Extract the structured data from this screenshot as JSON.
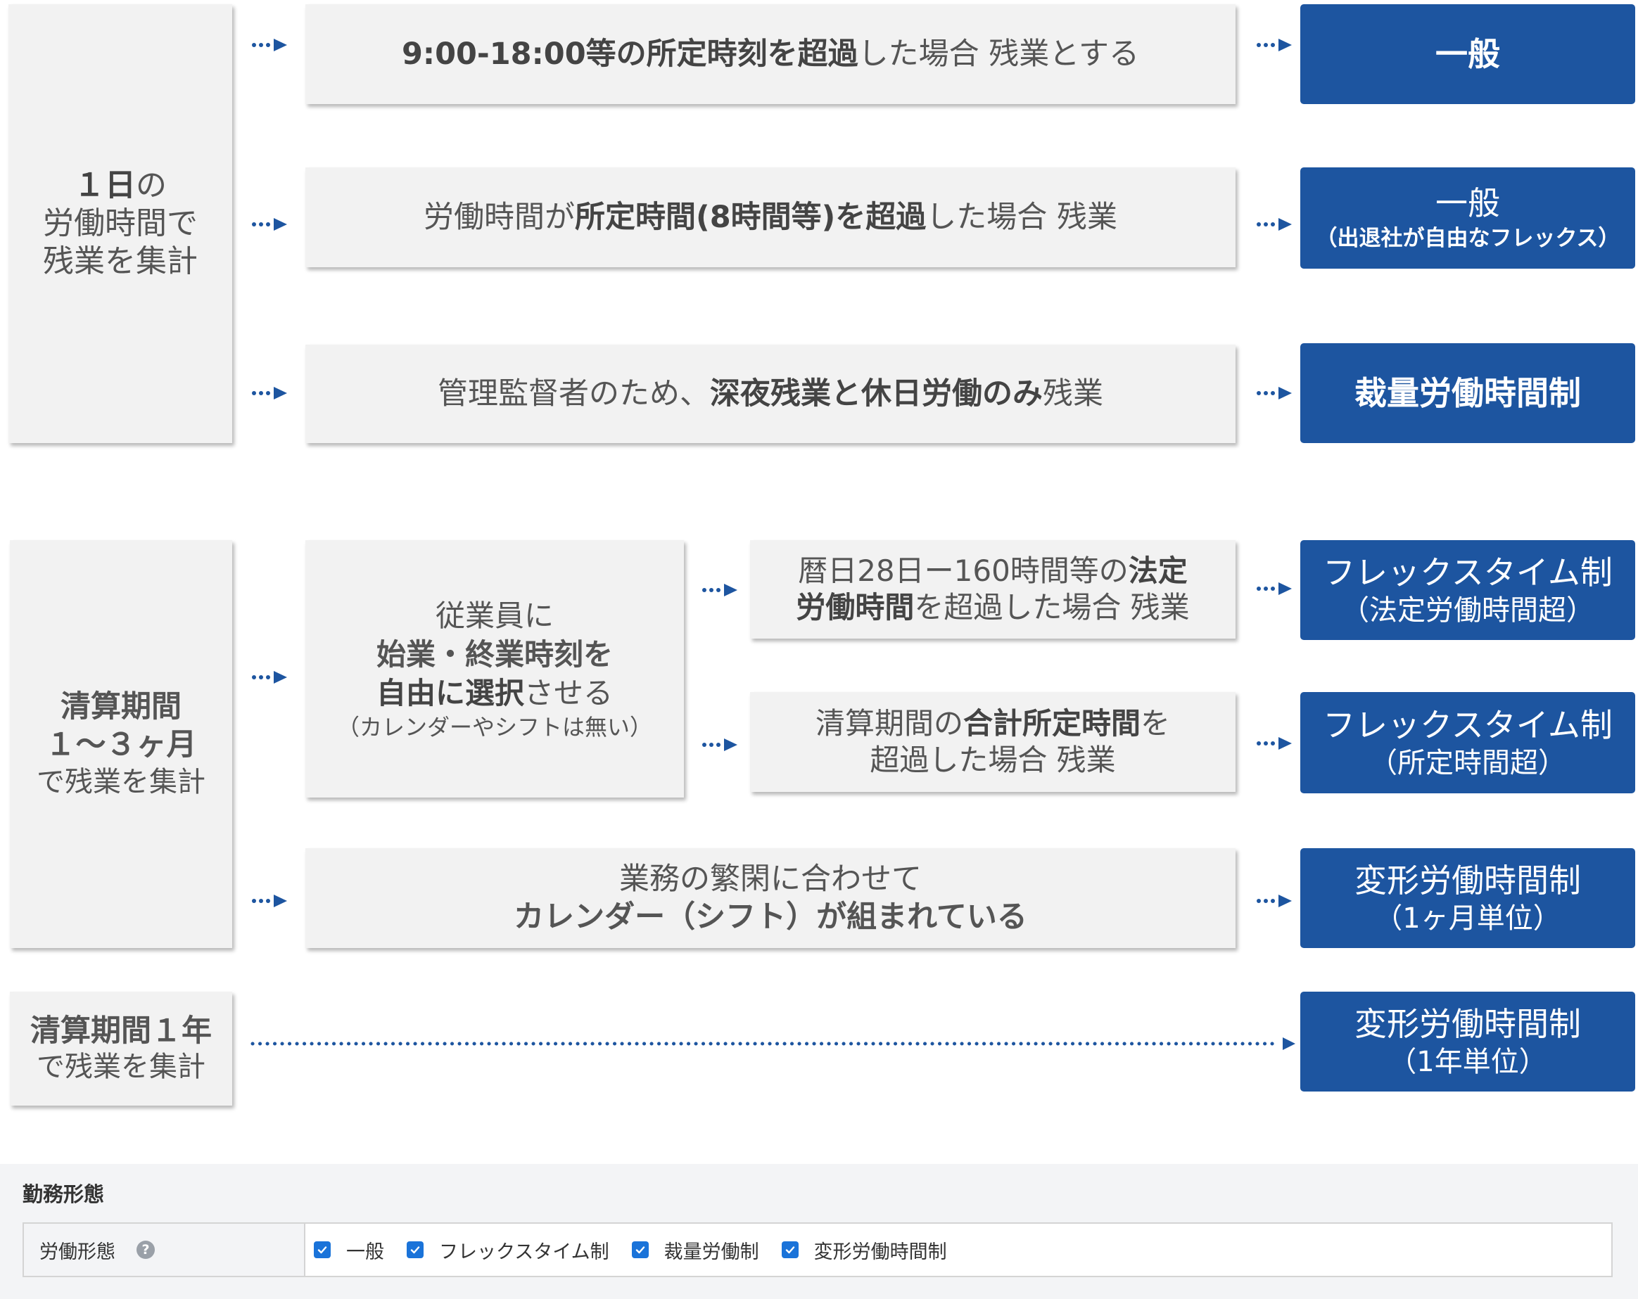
{
  "left_groups": {
    "g1": {
      "p1": "１日",
      "p1b": "の",
      "p2": "労働時間で",
      "p3": "残業を集計"
    },
    "g2": {
      "p1": "清算期間",
      "p2": "１～３ヶ月",
      "p3": "で残業を集計"
    },
    "g3": {
      "p1": "清算期間１年",
      "p2": "で残業を集計"
    }
  },
  "conditions": {
    "c1": {
      "bold": "9:00-18:00等の所定時刻を超過",
      "rest": "した場合 残業とする"
    },
    "c2": {
      "pre": "労働時間が",
      "bold": "所定時間(8時間等)を超過",
      "rest": "した場合 残業"
    },
    "c3": {
      "pre": "管理監督者のため、",
      "bold": "深夜残業と休日労働のみ",
      "rest": "残業"
    },
    "flex": {
      "line1": "従業員に",
      "line2": "始業・終業時刻を",
      "line3_bold": "自由に選択",
      "line3_rest": "させる",
      "line4": "（カレンダーやシフトは無い）"
    },
    "c4": {
      "pre": "暦日28日ー160時間等の",
      "bold1": "法定",
      "bold2": "労働時間",
      "rest": "を超過した場合 残業"
    },
    "c5": {
      "pre": "清算期間の",
      "bold": "合計所定時間",
      "post": "を",
      "line2": "超過した場合 残業"
    },
    "c6": {
      "line1": "業務の繁閑に合わせて",
      "line2": "カレンダー（シフト）が組まれている"
    }
  },
  "results": {
    "r1": {
      "main": "一般"
    },
    "r2": {
      "main": "一般",
      "sub": "（出退社が自由なフレックス）"
    },
    "r3": {
      "main": "裁量労働時間制"
    },
    "r4": {
      "main": "フレックスタイム制",
      "sub": "（法定労働時間超）"
    },
    "r5": {
      "main": "フレックスタイム制",
      "sub": "（所定時間超）"
    },
    "r6": {
      "main": "変形労働時間制",
      "sub": "（1ヶ月単位）"
    },
    "r7": {
      "main": "変形労働時間制",
      "sub": "（1年単位）"
    }
  },
  "settings": {
    "section_title": "勤務形態",
    "row_label": "労働形態",
    "help_icon": "?",
    "options": [
      {
        "label": "一般",
        "checked": true
      },
      {
        "label": "フレックスタイム制",
        "checked": true
      },
      {
        "label": "裁量労働制",
        "checked": true
      },
      {
        "label": "変形労働時間制",
        "checked": true
      }
    ]
  },
  "colors": {
    "result_bg": "#1d55a0",
    "box_bg": "#f2f2f2",
    "arrow": "#1d55a0",
    "checkbox": "#1a73d9"
  }
}
